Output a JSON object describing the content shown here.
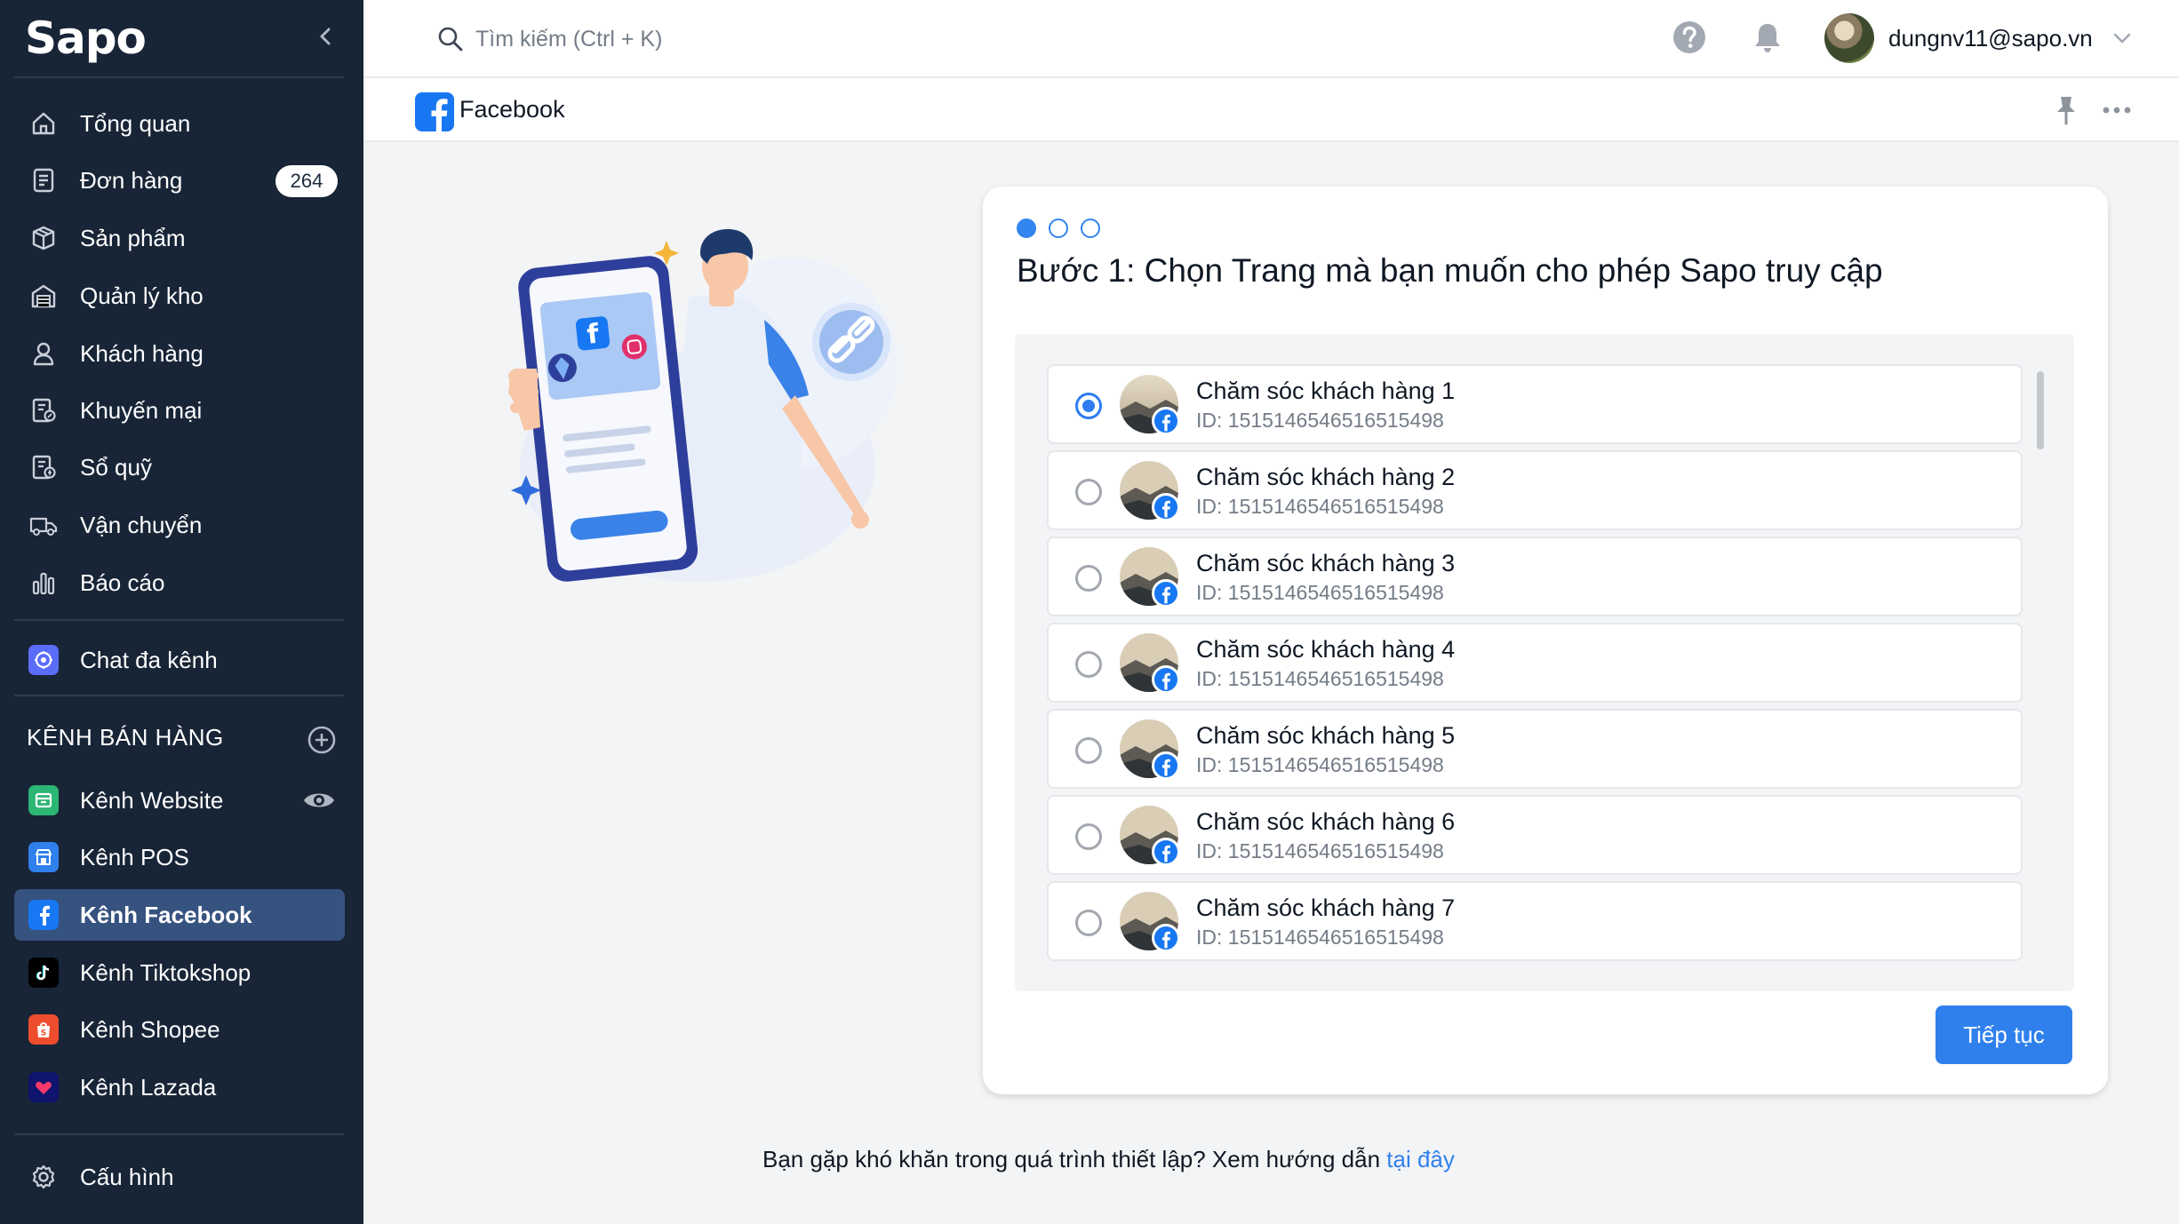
{
  "app": {
    "logo": "Sapo"
  },
  "sidebar": {
    "items": [
      {
        "label": "Tổng quan",
        "icon": "home-icon"
      },
      {
        "label": "Đơn hàng",
        "icon": "orders-icon",
        "badge": "264"
      },
      {
        "label": "Sản phẩm",
        "icon": "box-icon"
      },
      {
        "label": "Quản lý kho",
        "icon": "warehouse-icon"
      },
      {
        "label": "Khách hàng",
        "icon": "user-icon"
      },
      {
        "label": "Khuyến mại",
        "icon": "promotion-icon"
      },
      {
        "label": "Sổ quỹ",
        "icon": "cashbook-icon"
      },
      {
        "label": "Vận chuyển",
        "icon": "truck-icon"
      },
      {
        "label": "Báo cáo",
        "icon": "report-icon"
      }
    ],
    "chat": {
      "label": "Chat đa kênh",
      "icon": "chat-icon"
    },
    "section_title": "KÊNH BÁN HÀNG",
    "channels": [
      {
        "label": "Kênh Website",
        "icon": "website-icon",
        "color": "#2BB673"
      },
      {
        "label": "Kênh POS",
        "icon": "pos-icon",
        "color": "#2F80ED"
      },
      {
        "label": "Kênh Facebook",
        "icon": "facebook-icon",
        "color": "#1877F2",
        "active": true
      },
      {
        "label": "Kênh Tiktokshop",
        "icon": "tiktok-icon",
        "color": "#000000"
      },
      {
        "label": "Kênh Shopee",
        "icon": "shopee-icon",
        "color": "#EE4D2D"
      },
      {
        "label": "Kênh Lazada",
        "icon": "lazada-icon",
        "color": "#0F146D"
      }
    ],
    "settings": {
      "label": "Cấu hình",
      "icon": "gear-icon"
    }
  },
  "topbar": {
    "search_placeholder": "Tìm kiếm (Ctrl + K)",
    "user_email": "dungnv11@sapo.vn"
  },
  "page": {
    "title": "Facebook"
  },
  "card": {
    "steps_total": 3,
    "step_current": 1,
    "title": "Bước 1: Chọn Trang mà bạn muốn cho phép Sapo truy cập",
    "pages": [
      {
        "name": "Chăm sóc khách hàng 1",
        "id": "ID: 1515146546516515498",
        "selected": true
      },
      {
        "name": "Chăm sóc khách hàng 2",
        "id": "ID: 1515146546516515498",
        "selected": false
      },
      {
        "name": "Chăm sóc khách hàng 3",
        "id": "ID: 1515146546516515498",
        "selected": false
      },
      {
        "name": "Chăm sóc khách hàng 4",
        "id": "ID: 1515146546516515498",
        "selected": false
      },
      {
        "name": "Chăm sóc khách hàng 5",
        "id": "ID: 1515146546516515498",
        "selected": false
      },
      {
        "name": "Chăm sóc khách hàng 6",
        "id": "ID: 1515146546516515498",
        "selected": false
      },
      {
        "name": "Chăm sóc khách hàng 7",
        "id": "ID: 1515146546516515498",
        "selected": false
      }
    ],
    "continue_label": "Tiếp tục"
  },
  "footer": {
    "help_text": "Bạn gặp khó khăn trong quá trình thiết lập? Xem hướng dẫn ",
    "help_link": "tại đây"
  },
  "colors": {
    "sidebar_bg": "#182537",
    "active_bg": "#36527F",
    "primary": "#2F80ED",
    "facebook": "#1877F2"
  }
}
